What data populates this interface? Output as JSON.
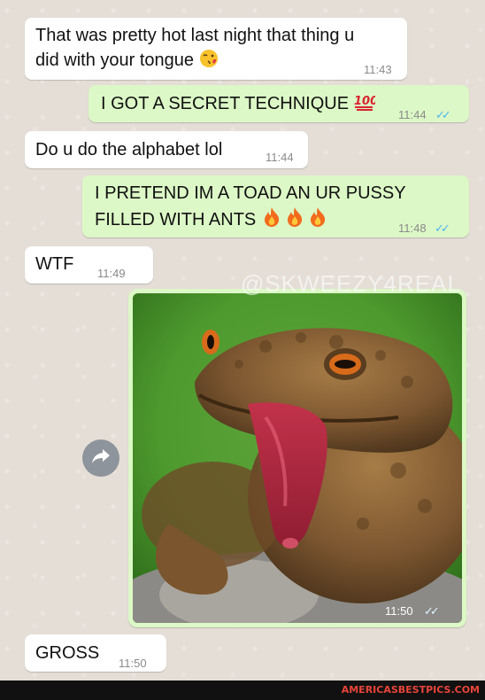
{
  "messages": [
    {
      "side": "in",
      "lines": [
        "That was pretty hot last night that thing u",
        "did with your tongue"
      ],
      "emoji": "kissing-face",
      "time": "11:43"
    },
    {
      "side": "out",
      "lines": [
        "I GOT A SECRET TECHNIQUE"
      ],
      "emoji": "hundred-points",
      "time": "11:44"
    },
    {
      "side": "in",
      "lines": [
        "Do u do the alphabet lol"
      ],
      "time": "11:44"
    },
    {
      "side": "out",
      "lines": [
        "I PRETEND IM A TOAD AN UR PUSSY",
        "FILLED WITH ANTS"
      ],
      "emoji": "fire x3",
      "time": "11:48"
    },
    {
      "side": "in",
      "lines": [
        "WTF"
      ],
      "time": "11:49"
    },
    {
      "side": "out",
      "type": "image",
      "image": "toad-sticking-out-tongue",
      "time": "11:50"
    },
    {
      "side": "in",
      "lines": [
        "GROSS"
      ],
      "time": "11:50"
    }
  ],
  "watermark": "@SKWEEZY4REAL",
  "footer": "AMERICASBESTPICS.COM",
  "colors": {
    "incoming": "#ffffff",
    "outgoing": "#dcf8c6",
    "read_ticks": "#4fb6ec"
  }
}
